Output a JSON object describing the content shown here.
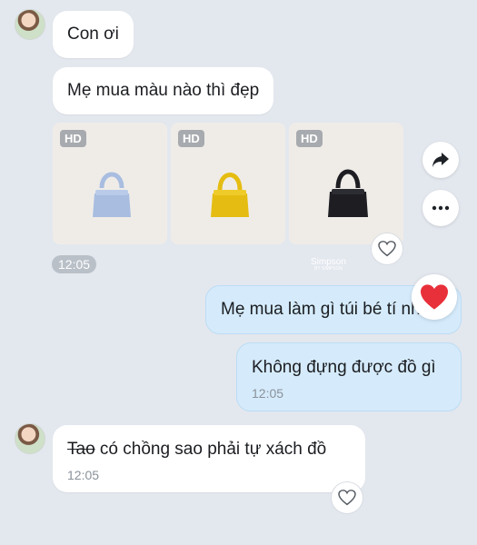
{
  "chat": {
    "msg1": {
      "text": "Con ơi"
    },
    "msg2": {
      "text": "Mẹ mua màu nào thì đẹp"
    },
    "photos": {
      "badge": "HD",
      "items": [
        {
          "bag_color": "#a8bde0"
        },
        {
          "bag_color": "#e5bd12"
        },
        {
          "bag_color": "#1d1d22"
        }
      ],
      "time": "12:05",
      "watermark": "Simpson",
      "watermark_sub": "BY SIMPSON"
    },
    "msg3": {
      "text": "Mẹ mua làm gì túi bé tí nhỉ"
    },
    "msg4": {
      "text": "Không đựng được đồ gì",
      "time": "12:05"
    },
    "msg5": {
      "strike_text": "Tao",
      "text": " có chồng sao phải tự xách đồ",
      "time": "12:05"
    }
  },
  "icons": {
    "share": "share-icon",
    "more": "more-icon",
    "heart_outline": "heart-outline-icon",
    "heart_reaction": "heart-filled-icon"
  },
  "colors": {
    "background": "#e3e7ee",
    "incoming_bubble": "#ffffff",
    "outgoing_bubble": "#d5ebfb",
    "reaction": "#e8303a"
  }
}
